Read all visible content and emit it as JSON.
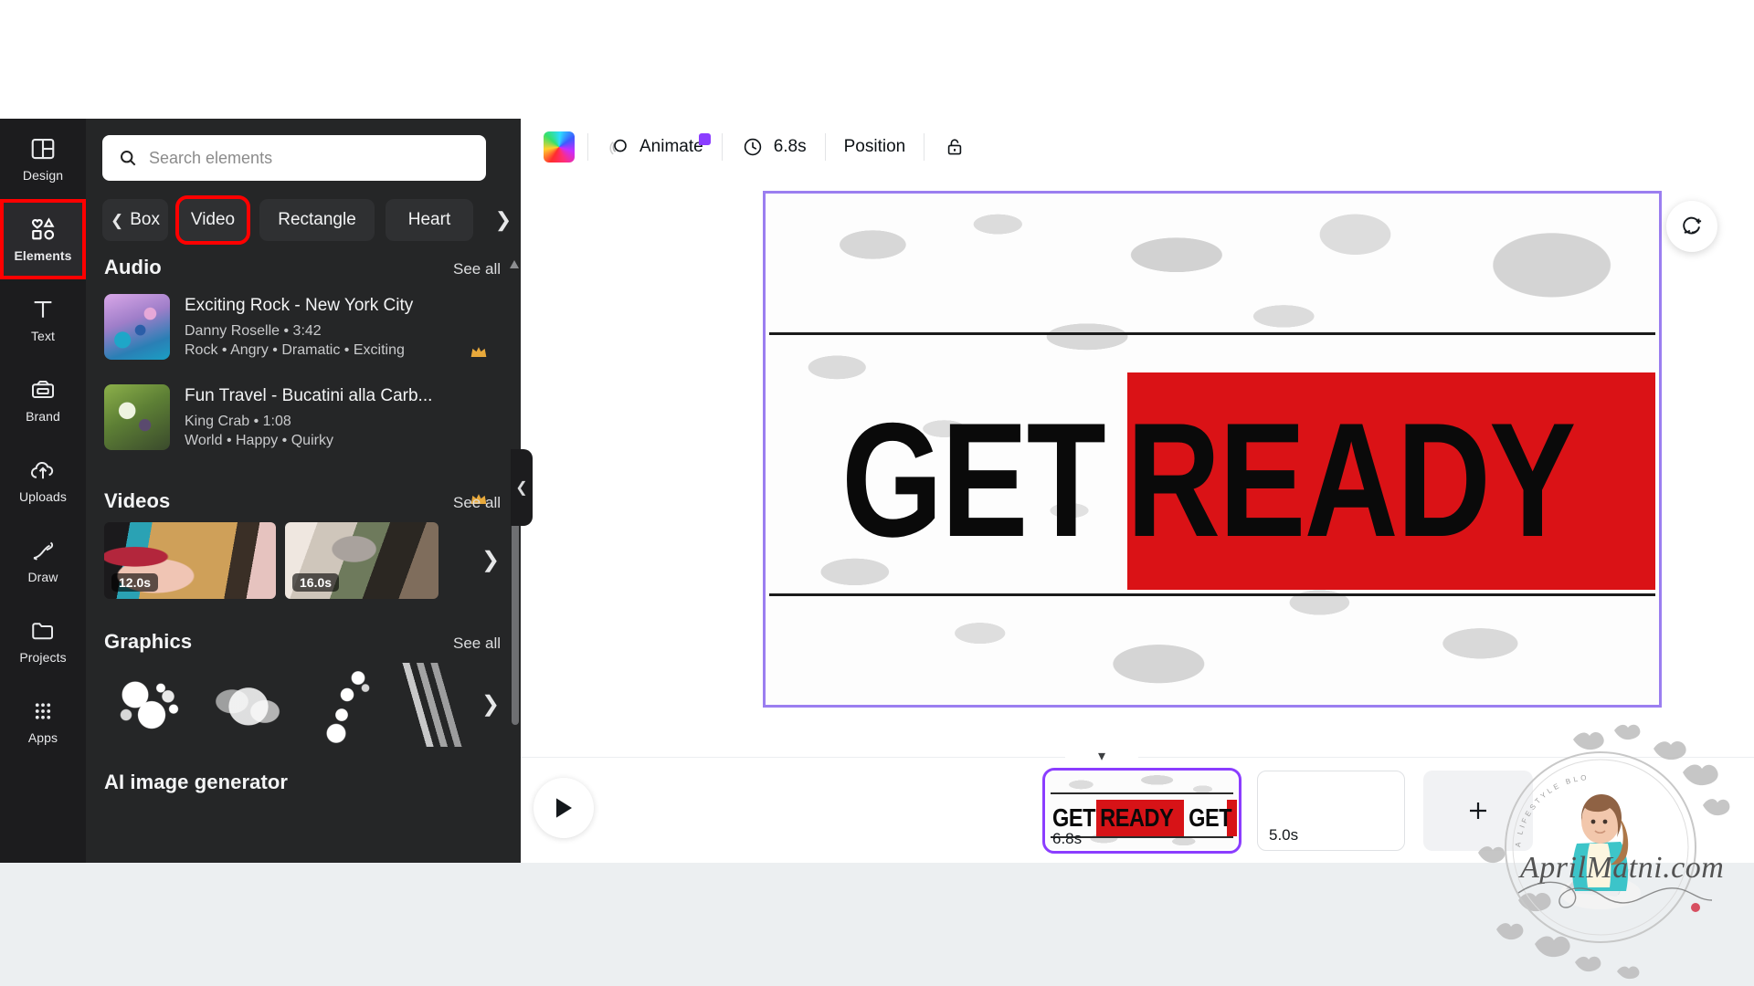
{
  "app": {
    "name": "Canva Video Editor"
  },
  "rail": {
    "items": [
      {
        "label": "Design",
        "icon": "layout-icon",
        "active": false
      },
      {
        "label": "Elements",
        "icon": "shapes-icon",
        "active": true,
        "highlighted": true
      },
      {
        "label": "Text",
        "icon": "text-icon",
        "active": false
      },
      {
        "label": "Brand",
        "icon": "brand-icon",
        "active": false
      },
      {
        "label": "Uploads",
        "icon": "upload-cloud-icon",
        "active": false
      },
      {
        "label": "Draw",
        "icon": "pen-icon",
        "active": false
      },
      {
        "label": "Projects",
        "icon": "folder-icon",
        "active": false
      },
      {
        "label": "Apps",
        "icon": "grid-apps-icon",
        "active": false
      }
    ]
  },
  "panel": {
    "search": {
      "placeholder": "Search elements",
      "value": "",
      "icon": "search-icon"
    },
    "chips": [
      {
        "label": "Box",
        "leading_icon": "chevron-left-icon",
        "highlighted": false
      },
      {
        "label": "Video",
        "highlighted": true
      },
      {
        "label": "Rectangle",
        "highlighted": false
      },
      {
        "label": "Heart",
        "highlighted": false
      }
    ],
    "chips_next_icon": "chevron-right-icon",
    "sections": {
      "audio": {
        "title": "Audio",
        "see_all": "See all",
        "items": [
          {
            "title": "Exciting Rock - New York City",
            "artist_duration": "Danny Roselle • 3:42",
            "tags": "Rock • Angry • Dramatic • Exciting",
            "pro": true
          },
          {
            "title": "Fun Travel - Bucatini alla Carb...",
            "artist_duration": "King Crab • 1:08",
            "tags": "World • Happy • Quirky",
            "pro": true
          }
        ]
      },
      "videos": {
        "title": "Videos",
        "see_all": "See all",
        "items": [
          {
            "duration": "12.0s"
          },
          {
            "duration": "16.0s"
          }
        ],
        "next_icon": "chevron-right-icon"
      },
      "graphics": {
        "title": "Graphics",
        "see_all": "See all",
        "items": [
          {
            "name": "paint-splatter-graphic"
          },
          {
            "name": "grunge-smear-graphic"
          },
          {
            "name": "ink-drip-graphic"
          },
          {
            "name": "brush-stroke-graphic"
          }
        ],
        "next_icon": "chevron-right-icon"
      },
      "ai_image_generator": {
        "title": "AI image generator"
      }
    },
    "collapse_icon": "chevron-left-icon"
  },
  "toolbar": {
    "color_swatch": {
      "name": "color-swatch",
      "label": ""
    },
    "animate": {
      "label": "Animate",
      "icon": "animate-icon",
      "pro_badge": true
    },
    "duration": {
      "label": "6.8s",
      "icon": "clock-icon"
    },
    "position": {
      "label": "Position"
    },
    "lock": {
      "icon": "lock-icon"
    }
  },
  "canvas": {
    "headline": {
      "word1": "GET",
      "word2": "READY"
    },
    "red_block_color": "#da1216",
    "selection_color": "#9b7ef0",
    "comment_button": {
      "icon": "comment-add-icon"
    }
  },
  "timeline": {
    "play_button": {
      "icon": "play-icon"
    },
    "collapse_icon": "chevron-down-icon",
    "playhead": {
      "icon": "playhead-marker-icon"
    },
    "scenes": [
      {
        "duration": "6.8s",
        "selected": true,
        "preview_words": [
          "GET",
          "READY",
          "GET"
        ]
      },
      {
        "duration": "5.0s",
        "selected": false,
        "preview_words": []
      }
    ],
    "add_page": {
      "icon": "plus-icon"
    }
  },
  "watermark": {
    "brand": "AprilMatni.com",
    "tagline": "A LIFESTYLE BLOGGER"
  },
  "colors": {
    "accent_purple": "#8b3dff",
    "highlight_red": "#ff0000",
    "panel_bg": "#252627",
    "rail_bg": "#1c1c1e",
    "brand_red": "#da1216"
  }
}
